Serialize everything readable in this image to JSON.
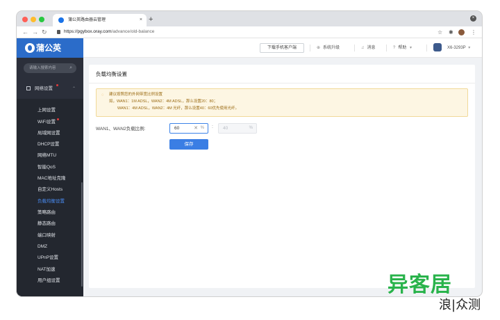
{
  "browser": {
    "tab_title": "蒲公英路由器云管理",
    "new_tab": "+",
    "tab_close": "×",
    "url_host": "https://pgybox.oray.com",
    "url_path": "/advance/old-balance"
  },
  "header": {
    "logo_text": "蒲公英",
    "download_btn": "下载手机客户端",
    "upgrade": "系统升级",
    "messages": "消息",
    "help": "帮助",
    "help_caret": "▾",
    "device": "X6-3293P",
    "device_caret": "▾"
  },
  "sidebar": {
    "search_placeholder": "请输入搜索内容",
    "group": "网络设置",
    "items": [
      {
        "label": "上网设置"
      },
      {
        "label": "WiFi设置"
      },
      {
        "label": "局域网设置"
      },
      {
        "label": "DHCP设置"
      },
      {
        "label": "网络MTU"
      },
      {
        "label": "智能QoS"
      },
      {
        "label": "MAC地址克隆"
      },
      {
        "label": "自定义Hosts"
      },
      {
        "label": "负载均衡设置"
      },
      {
        "label": "策略路由"
      },
      {
        "label": "静态路由"
      },
      {
        "label": "端口映射"
      },
      {
        "label": "DMZ"
      },
      {
        "label": "UPnP设置"
      },
      {
        "label": "NAT加速"
      },
      {
        "label": "用户组设置"
      }
    ]
  },
  "main": {
    "title": "负载均衡设置",
    "notice": {
      "line1": "建议按照您的外网带宽比例设置",
      "line2": "如，WAN1：1M ADSL，WAN2：4M ADSL，那么设置20：80；",
      "line3": "WAN1：4M ADSL，WAN2：4M 光纤，那么设置40：60优先使用光纤。"
    },
    "ratio_label": "WAN1、WAN2负载比例:",
    "wan1_value": "60",
    "wan2_value": "40",
    "percent": "%",
    "clear": "✕",
    "colon": ":",
    "save_btn": "保存"
  },
  "watermark": {
    "line1": "异客居",
    "line2": "浪|众测"
  }
}
